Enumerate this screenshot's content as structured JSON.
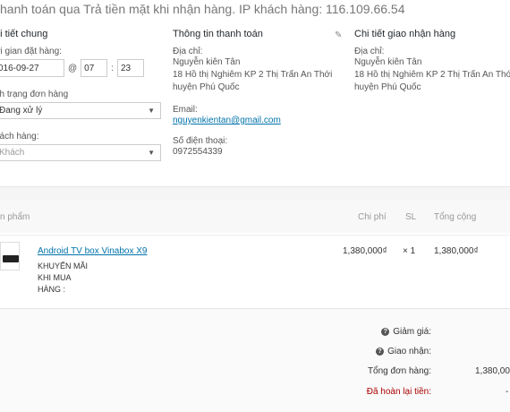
{
  "header": {
    "sentence": "hanh toán qua Trả tiền mặt khi nhận hàng. IP khách hàng: 116.109.66.54"
  },
  "general": {
    "title": "hi tiết chung",
    "date_label": "ời gian đặt hàng:",
    "date_value": "016-09-27",
    "at": "@",
    "hour": "07",
    "minute": "23",
    "status_label": "nh trạng đơn hàng",
    "status_value": "Đang xử lý",
    "customer_label": "hách hàng:",
    "customer_placeholder": "Khách"
  },
  "billing": {
    "title": "Thông tin thanh toán",
    "address_label": "Địa chỉ:",
    "address_line1": "Nguyễn kiên Tân",
    "address_line2": "18 Hồ thị Nghiêm KP 2 Thị Trấn An Thới",
    "address_line3": "huyện Phú Quốc",
    "email_label": "Email:",
    "email": "nguyenkientan@gmail.com",
    "phone_label": "Số điện thoại:",
    "phone": "0972554339"
  },
  "shipping": {
    "title": "Chi tiết giao nhận hàng",
    "address_label": "Địa chỉ:",
    "address_line1": "Nguyễn kiên Tân",
    "address_line2": "18 Hồ thị Nghiêm KP 2 Thị Trấn An Thới",
    "address_line3": "huyện Phú Quốc"
  },
  "items": {
    "columns": {
      "product": "n phẩm",
      "cost": "Chi phí",
      "qty": "SL",
      "total": "Tổng cộng"
    },
    "rows": [
      {
        "name": "Android TV box Vinabox X9",
        "meta1": "KHUYẾN MÃI",
        "meta2": "KHI MUA",
        "meta3": "HÀNG :",
        "cost": "1,380,000₫",
        "qty": "× 1",
        "total": "1,380,000₫"
      }
    ]
  },
  "totals": {
    "discount_label": "Giảm giá:",
    "shipping_label": "Giao nhận:",
    "order_total_label": "Tổng đơn hàng:",
    "order_total_value": "1,380,00",
    "refunded_label": "Đã hoàn lại tiền:",
    "refunded_value": "-"
  },
  "icons": {
    "pencil": "pencil-icon",
    "help": "help-icon",
    "chevron": "chevron-down-icon"
  }
}
